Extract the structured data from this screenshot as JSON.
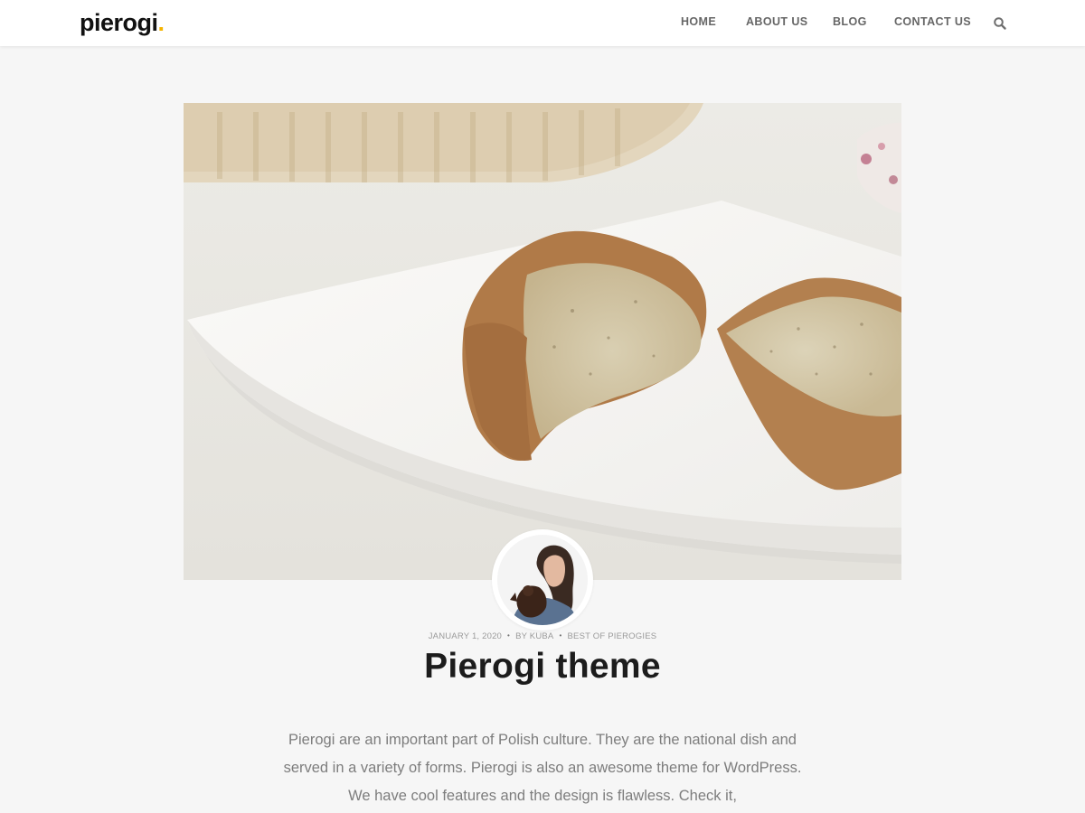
{
  "site": {
    "logo_text": "pierogi",
    "logo_dot": ".",
    "accent_color": "#f5b400"
  },
  "nav": {
    "items": [
      {
        "label": "HOME"
      },
      {
        "label": "ABOUT US"
      },
      {
        "label": "BLOG"
      },
      {
        "label": "CONTACT US"
      }
    ],
    "search_icon": "search-icon"
  },
  "post": {
    "featured_image": "muffins-on-white-plate",
    "author_avatar": "author-avatar",
    "date": "JANUARY 1, 2020",
    "author": "BY KUBA",
    "category": "BEST OF PIEROGIES",
    "meta_separator": "•",
    "title": "Pierogi theme",
    "excerpt": "Pierogi are an important part of Polish culture. They are the national dish and served in a variety of forms. Pierogi is also an awesome theme for WordPress. We have cool features and the design is flawless. Check it,"
  }
}
